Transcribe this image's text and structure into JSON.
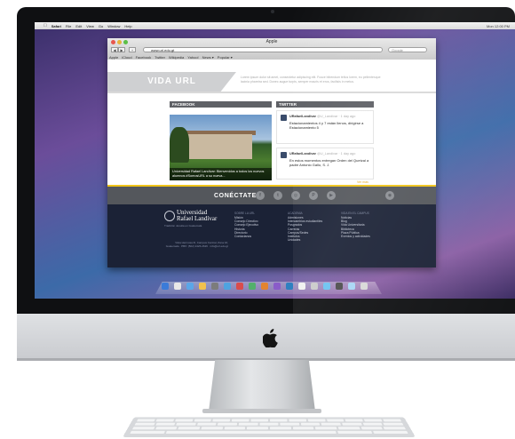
{
  "menubar": {
    "apple": "",
    "items": [
      "Safari",
      "File",
      "Edit",
      "View",
      "Go",
      "Window",
      "Help"
    ],
    "status": "Mon 12:00 PM"
  },
  "browser": {
    "window_title": "Apple",
    "url": "www.url.edu.gt",
    "search_placeholder": "Google",
    "back": "◀",
    "forward": "▶",
    "bookmarks": [
      "Apple",
      "iCloud",
      "Facebook",
      "Twitter",
      "Wikipedia",
      "Yahoo!",
      "News ▾",
      "Popular ▾"
    ]
  },
  "page": {
    "hero_title": "VIDA URL",
    "hero_text": "Lorem ipsum dolor sit amet, consectetur adipiscing elit. Fusce bibendum tellus lorem, eu pellentesque lacinia pharetra sed. Donec augue turpis, semper mauris et eros, facilisis in metus.",
    "facebook_header": "FACEBOOK",
    "twitter_header": "TWITTER",
    "photo_caption": "Universidad Rafael Landívar: Bienvenidos a todos los nuevos alumnos #SomosURL a su nueva...",
    "tweets": [
      {
        "handle": "URafaelLandivar",
        "meta": "@U_Landivar · 1 day ago",
        "text": "Estacionamientos 4 y 7 están llenos, dirigirse a Estacionamiento 5"
      },
      {
        "handle": "URafaelLandivar",
        "meta": "@U_Landivar · 1 day ago",
        "text": "En estos momentos entregan Orden del Quetzal a padre Antonio Gallo, S. J."
      }
    ],
    "ver_mas": "Ver más",
    "connect_label": "CONÉCTATE",
    "social_icons": [
      "f",
      "t",
      "◎",
      "P",
      "▶"
    ],
    "footer": {
      "logo_line1": "Universidad",
      "logo_line2": "Rafael Landívar",
      "logo_tagline": "Tradición Jesuita en Guatemala",
      "address": "Vista Hermosa III, Campus Central, Zona 16, Guatemala · PBX: (502) 2426-2626 · info@url.edu.gt",
      "columns": [
        {
          "header": "SOBRE LA URL",
          "items": [
            "Misión",
            "Consejo Directivo",
            "Consejo Ejecutivo",
            "Historia",
            "Directorio",
            "Contáctanos"
          ]
        },
        {
          "header": "ACADEMIA",
          "items": [
            "Admisiones",
            "Intercambios estudiantiles",
            "Posgrados",
            "Carreras",
            "Campus/Sedes",
            "Institutos",
            "Unidades"
          ]
        },
        {
          "header": "VIDA EN EL CAMPUS",
          "items": [
            "Noticias",
            "Blog",
            "Vida Universitaria",
            "Biblioteca",
            "Plaza Pública",
            "Eventos y actividades"
          ]
        }
      ]
    }
  },
  "colors": {
    "accent_gold": "#f0c419",
    "footer_navy": "#1b2236",
    "connect_gray": "#54575c"
  }
}
